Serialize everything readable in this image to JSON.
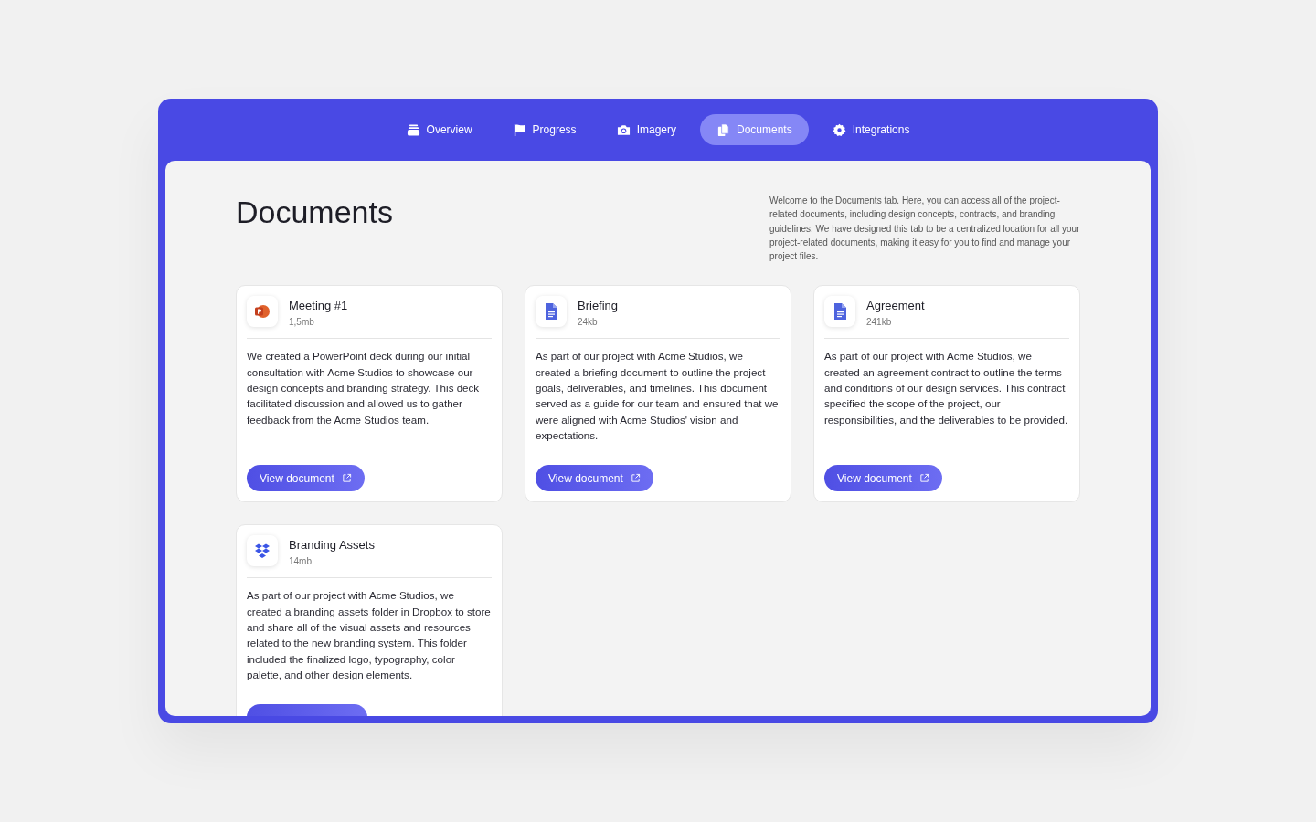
{
  "tabs": [
    {
      "label": "Overview",
      "selected": false
    },
    {
      "label": "Progress",
      "selected": false
    },
    {
      "label": "Imagery",
      "selected": false
    },
    {
      "label": "Documents",
      "selected": true
    },
    {
      "label": "Integrations",
      "selected": false
    }
  ],
  "page": {
    "title": "Documents",
    "intro": "Welcome to the Documents tab. Here, you can access all of the project-related documents, including design concepts, contracts, and branding guidelines. We have designed this tab to be a centralized location for all your project-related documents, making it easy for you to find and manage your project files."
  },
  "documents": [
    {
      "kind": "slides",
      "name": "Meeting #1",
      "size": "1,5mb",
      "description": "We created a PowerPoint deck during our initial consultation with Acme Studios to showcase our design concepts and branding strategy. This deck facilitated discussion and allowed us to gather feedback from the Acme Studios team.",
      "button": "View document"
    },
    {
      "kind": "doc",
      "name": "Briefing",
      "size": "24kb",
      "description": "As part of our project with Acme Studios, we created a briefing document to outline the project goals, deliverables, and timelines. This document served as a guide for our team and ensured that we were aligned with Acme Studios' vision and expectations.",
      "button": "View document"
    },
    {
      "kind": "doc",
      "name": "Agreement",
      "size": "241kb",
      "description": "As part of our project with Acme Studios, we created an agreement contract to outline the terms and conditions of our design services. This contract specified the scope of the project, our responsibilities, and the deliverables to be provided.",
      "button": "View document"
    },
    {
      "kind": "box",
      "name": "Branding Assets",
      "size": "14mb",
      "description": "As part of our project with Acme Studios, we created a branding assets folder in Dropbox to store and share all of the visual assets and resources related to the new branding system. This folder included the finalized logo, typography, color palette, and other design elements."
    }
  ]
}
